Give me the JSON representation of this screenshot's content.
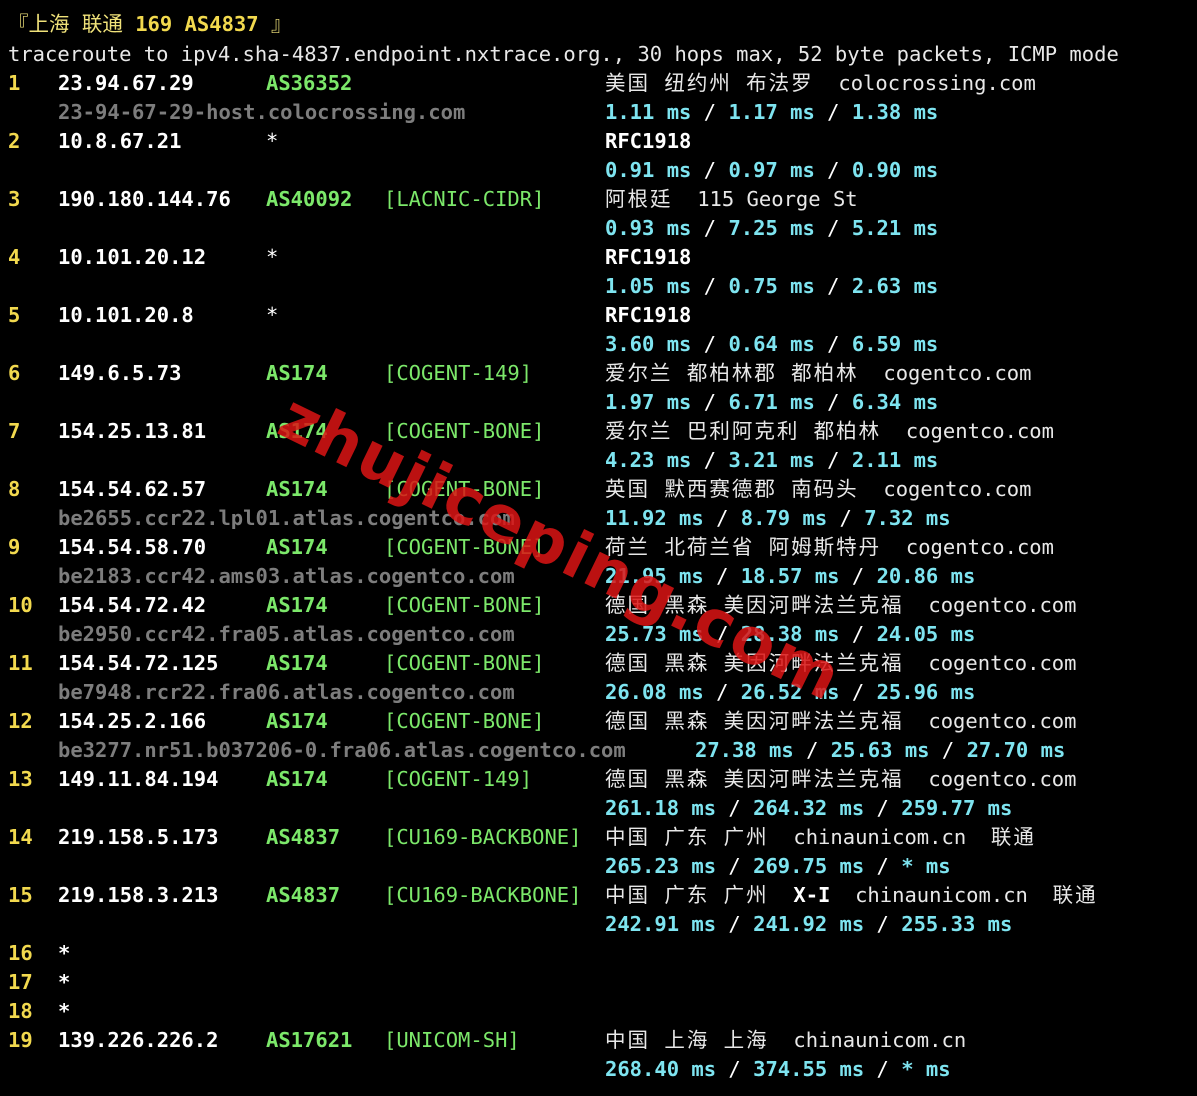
{
  "header": {
    "title_prefix": "『上海 联通 ",
    "title_bold": "169 AS4837",
    "title_suffix": " 』",
    "trace_line": "traceroute to ipv4.sha-4837.endpoint.nxtrace.org., 30 hops max, 52 byte packets, ICMP mode"
  },
  "hops": [
    {
      "n": "1",
      "ip": "23.94.67.29",
      "asn": "AS36352",
      "tag": "",
      "geo": "美国 纽约州 布法罗",
      "geo_bold": "",
      "domain": "colocrossing.com",
      "isp": "",
      "host": "23-94-67-29-host.colocrossing.com",
      "rtt": [
        "1.11 ms",
        "1.17 ms",
        "1.38 ms"
      ]
    },
    {
      "n": "2",
      "ip": "10.8.67.21",
      "asn": "*",
      "tag": "",
      "geo": "",
      "geo_bold": "RFC1918",
      "domain": "",
      "isp": "",
      "host": "",
      "rtt": [
        "0.91 ms",
        "0.97 ms",
        "0.90 ms"
      ]
    },
    {
      "n": "3",
      "ip": "190.180.144.76",
      "asn": "AS40092",
      "tag": "[LACNIC-CIDR]",
      "geo": "阿根廷",
      "geo_bold": "",
      "domain": "115 George St",
      "isp": "",
      "host": "",
      "rtt": [
        "0.93 ms",
        "7.25 ms",
        "5.21 ms"
      ]
    },
    {
      "n": "4",
      "ip": "10.101.20.12",
      "asn": "*",
      "tag": "",
      "geo": "",
      "geo_bold": "RFC1918",
      "domain": "",
      "isp": "",
      "host": "",
      "rtt": [
        "1.05 ms",
        "0.75 ms",
        "2.63 ms"
      ]
    },
    {
      "n": "5",
      "ip": "10.101.20.8",
      "asn": "*",
      "tag": "",
      "geo": "",
      "geo_bold": "RFC1918",
      "domain": "",
      "isp": "",
      "host": "",
      "rtt": [
        "3.60 ms",
        "0.64 ms",
        "6.59 ms"
      ]
    },
    {
      "n": "6",
      "ip": "149.6.5.73",
      "asn": "AS174",
      "tag": "[COGENT-149]",
      "geo": "爱尔兰 都柏林郡 都柏林",
      "geo_bold": "",
      "domain": "cogentco.com",
      "isp": "",
      "host": "",
      "rtt": [
        "1.97 ms",
        "6.71 ms",
        "6.34 ms"
      ]
    },
    {
      "n": "7",
      "ip": "154.25.13.81",
      "asn": "AS174",
      "tag": "[COGENT-BONE]",
      "geo": "爱尔兰 巴利阿克利 都柏林",
      "geo_bold": "",
      "domain": "cogentco.com",
      "isp": "",
      "host": "",
      "rtt": [
        "4.23 ms",
        "3.21 ms",
        "2.11 ms"
      ]
    },
    {
      "n": "8",
      "ip": "154.54.62.57",
      "asn": "AS174",
      "tag": "[COGENT-BONE]",
      "geo": "英国 默西赛德郡 南码头",
      "geo_bold": "",
      "domain": "cogentco.com",
      "isp": "",
      "host": "be2655.ccr22.lpl01.atlas.cogentco.com",
      "rtt": [
        "11.92 ms",
        "8.79 ms",
        "7.32 ms"
      ]
    },
    {
      "n": "9",
      "ip": "154.54.58.70",
      "asn": "AS174",
      "tag": "[COGENT-BONE]",
      "geo": "荷兰 北荷兰省 阿姆斯特丹",
      "geo_bold": "",
      "domain": "cogentco.com",
      "isp": "",
      "host": "be2183.ccr42.ams03.atlas.cogentco.com",
      "rtt": [
        "21.95 ms",
        "18.57 ms",
        "20.86 ms"
      ]
    },
    {
      "n": "10",
      "ip": "154.54.72.42",
      "asn": "AS174",
      "tag": "[COGENT-BONE]",
      "geo": "德国 黑森 美因河畔法兰克福",
      "geo_bold": "",
      "domain": "cogentco.com",
      "isp": "",
      "host": "be2950.ccr42.fra05.atlas.cogentco.com",
      "rtt": [
        "25.73 ms",
        "28.38 ms",
        "24.05 ms"
      ]
    },
    {
      "n": "11",
      "ip": "154.54.72.125",
      "asn": "AS174",
      "tag": "[COGENT-BONE]",
      "geo": "德国 黑森 美因河畔法兰克福",
      "geo_bold": "",
      "domain": "cogentco.com",
      "isp": "",
      "host": "be7948.rcr22.fra06.atlas.cogentco.com",
      "rtt": [
        "26.08 ms",
        "26.52 ms",
        "25.96 ms"
      ]
    },
    {
      "n": "12",
      "ip": "154.25.2.166",
      "asn": "AS174",
      "tag": "[COGENT-BONE]",
      "geo": "德国 黑森 美因河畔法兰克福",
      "geo_bold": "",
      "domain": "cogentco.com",
      "isp": "",
      "host": "be3277.nr51.b037206-0.fra06.atlas.cogentco.com",
      "rtt": [
        "27.38 ms",
        "25.63 ms",
        "27.70 ms"
      ],
      "rtt_shift": true
    },
    {
      "n": "13",
      "ip": "149.11.84.194",
      "asn": "AS174",
      "tag": "[COGENT-149]",
      "geo": "德国 黑森 美因河畔法兰克福",
      "geo_bold": "",
      "domain": "cogentco.com",
      "isp": "",
      "host": "",
      "rtt": [
        "261.18 ms",
        "264.32 ms",
        "259.77 ms"
      ]
    },
    {
      "n": "14",
      "ip": "219.158.5.173",
      "asn": "AS4837",
      "tag": "[CU169-BACKBONE]",
      "geo": "中国 广东 广州",
      "geo_bold": "",
      "domain": "chinaunicom.cn",
      "isp": "联通",
      "host": "",
      "rtt": [
        "265.23 ms",
        "269.75 ms",
        "* ms"
      ]
    },
    {
      "n": "15",
      "ip": "219.158.3.213",
      "asn": "AS4837",
      "tag": "[CU169-BACKBONE]",
      "geo": "中国 广东 广州",
      "geo_bold": "X-I",
      "domain": "chinaunicom.cn",
      "isp": "联通",
      "host": "",
      "rtt": [
        "242.91 ms",
        "241.92 ms",
        "255.33 ms"
      ]
    },
    {
      "n": "16",
      "ip": "*",
      "asn": "",
      "tag": "",
      "geo": "",
      "geo_bold": "",
      "domain": "",
      "isp": "",
      "host": "",
      "rtt": []
    },
    {
      "n": "17",
      "ip": "*",
      "asn": "",
      "tag": "",
      "geo": "",
      "geo_bold": "",
      "domain": "",
      "isp": "",
      "host": "",
      "rtt": []
    },
    {
      "n": "18",
      "ip": "*",
      "asn": "",
      "tag": "",
      "geo": "",
      "geo_bold": "",
      "domain": "",
      "isp": "",
      "host": "",
      "rtt": []
    },
    {
      "n": "19",
      "ip": "139.226.226.2",
      "asn": "AS17621",
      "tag": "[UNICOM-SH]",
      "geo": "中国 上海 上海",
      "geo_bold": "",
      "domain": "chinaunicom.cn",
      "isp": "",
      "host": "",
      "rtt": [
        "268.40 ms",
        "374.55 ms",
        "* ms"
      ]
    }
  ],
  "watermark": "zhujiceping.com",
  "colors": {
    "background": "#000000",
    "hop_number": "#f2d94e",
    "asn": "#7ce86a",
    "rtt": "#7ee4f0",
    "hostname": "#7d7d7d",
    "watermark": "#dc1414"
  }
}
